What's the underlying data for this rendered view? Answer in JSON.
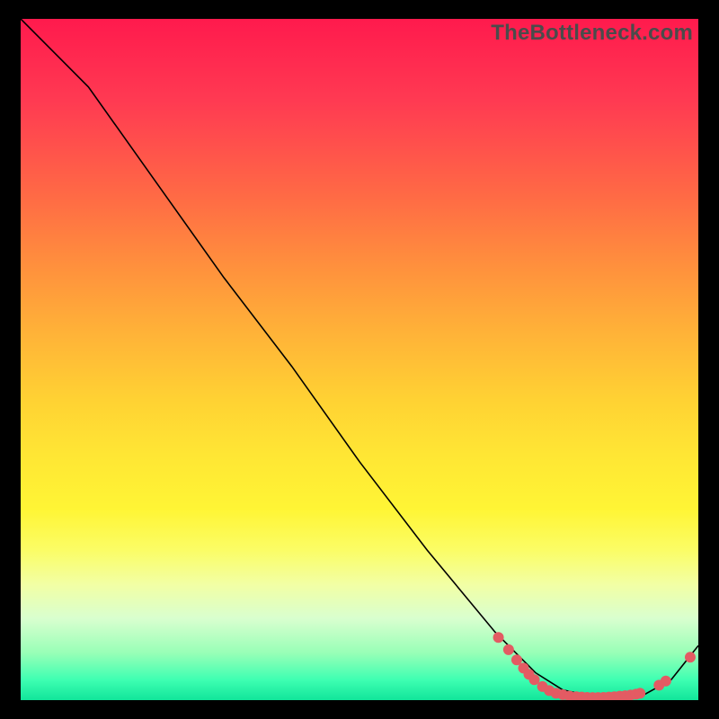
{
  "watermark": "TheBottleneck.com",
  "chart_data": {
    "type": "line",
    "title": "",
    "xlabel": "",
    "ylabel": "",
    "xlim": [
      0,
      100
    ],
    "ylim": [
      0,
      100
    ],
    "legend": false,
    "grid": false,
    "series": [
      {
        "name": "bottleneck-curve",
        "x": [
          0,
          6,
          10,
          20,
          30,
          40,
          50,
          60,
          70,
          76,
          80,
          84,
          88,
          92,
          96,
          100
        ],
        "y": [
          100,
          94,
          90,
          76,
          62,
          49,
          35,
          22,
          10,
          4,
          1.5,
          0.6,
          0.3,
          0.8,
          3,
          8
        ],
        "color": "#000000",
        "linewidth": 1.6
      }
    ],
    "points": {
      "name": "highlighted-points",
      "color": "#e35b63",
      "radius": 6,
      "coords": [
        [
          70.5,
          9.2
        ],
        [
          72.0,
          7.4
        ],
        [
          73.2,
          5.9
        ],
        [
          74.2,
          4.7
        ],
        [
          75.0,
          3.8
        ],
        [
          75.8,
          3.0
        ],
        [
          77.0,
          2.0
        ],
        [
          78.0,
          1.4
        ],
        [
          79.0,
          1.0
        ],
        [
          80.0,
          0.8
        ],
        [
          81.0,
          0.6
        ],
        [
          82.0,
          0.5
        ],
        [
          82.8,
          0.45
        ],
        [
          83.6,
          0.4
        ],
        [
          84.4,
          0.38
        ],
        [
          85.2,
          0.38
        ],
        [
          86.0,
          0.4
        ],
        [
          86.8,
          0.45
        ],
        [
          87.6,
          0.5
        ],
        [
          88.4,
          0.58
        ],
        [
          89.2,
          0.65
        ],
        [
          90.0,
          0.75
        ],
        [
          90.8,
          0.88
        ],
        [
          91.4,
          1.0
        ],
        [
          94.2,
          2.2
        ],
        [
          95.2,
          2.8
        ],
        [
          98.8,
          6.3
        ]
      ]
    },
    "background_gradient": {
      "stops": [
        {
          "pos": 0.0,
          "color": "#ff1a4d"
        },
        {
          "pos": 0.12,
          "color": "#ff3a52"
        },
        {
          "pos": 0.26,
          "color": "#ff6a45"
        },
        {
          "pos": 0.36,
          "color": "#ff8f3d"
        },
        {
          "pos": 0.46,
          "color": "#ffb238"
        },
        {
          "pos": 0.56,
          "color": "#ffd233"
        },
        {
          "pos": 0.64,
          "color": "#ffe634"
        },
        {
          "pos": 0.72,
          "color": "#fff535"
        },
        {
          "pos": 0.78,
          "color": "#fbfd66"
        },
        {
          "pos": 0.83,
          "color": "#f2ffa4"
        },
        {
          "pos": 0.88,
          "color": "#d9ffcf"
        },
        {
          "pos": 0.93,
          "color": "#99ffb7"
        },
        {
          "pos": 0.97,
          "color": "#3fffb2"
        },
        {
          "pos": 1.0,
          "color": "#11e59a"
        }
      ]
    }
  }
}
